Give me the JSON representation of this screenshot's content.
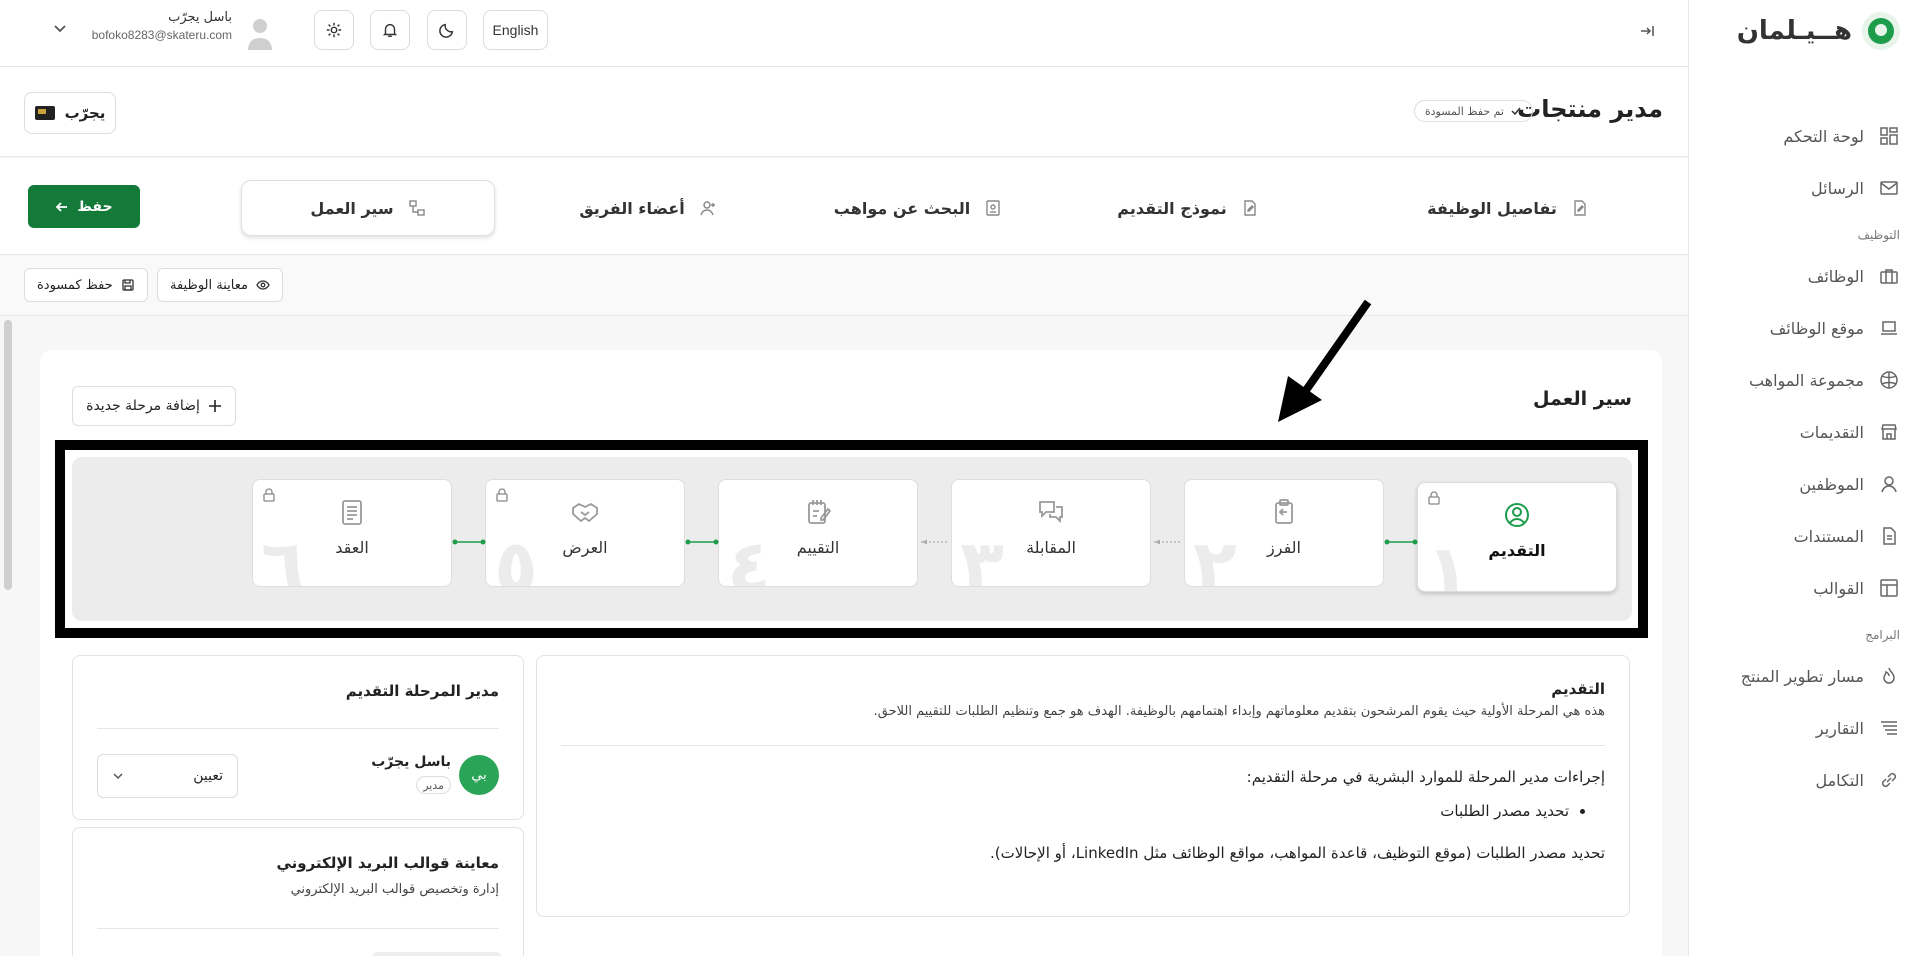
{
  "sidebar": {
    "brand": "هــيـلمان",
    "items": [
      {
        "label": "لوحة التحكم",
        "icon": "dashboard-icon"
      },
      {
        "label": "الرسائل",
        "icon": "mail-icon"
      }
    ],
    "section_hiring": "التوظيف",
    "hiring_items": [
      {
        "label": "الوظائف",
        "icon": "briefcase-icon"
      },
      {
        "label": "موقع الوظائف",
        "icon": "laptop-icon"
      },
      {
        "label": "مجموعة المواهب",
        "icon": "talent-pool-icon"
      },
      {
        "label": "التقديمات",
        "icon": "store-icon"
      },
      {
        "label": "الموظفين",
        "icon": "user-icon"
      },
      {
        "label": "المستندات",
        "icon": "document-icon"
      },
      {
        "label": "القوالب",
        "icon": "template-icon"
      }
    ],
    "section_programs": "البرامج",
    "program_items": [
      {
        "label": "مسار تطوير المنتج",
        "icon": "flame-icon"
      },
      {
        "label": "التقارير",
        "icon": "report-icon"
      },
      {
        "label": "التكامل",
        "icon": "link-icon"
      }
    ]
  },
  "topbar": {
    "language": "English",
    "user_name": "باسل يجرّب",
    "user_email": "bofoko8283@skateru.com"
  },
  "header": {
    "title": "مدير منتجات",
    "draft_badge": "تم حفظ المسودة",
    "company": "يجرّب"
  },
  "tabs": {
    "job_details": "تفاصيل الوظيفة",
    "application_form": "نموذج التقديم",
    "talent_search": "البحث عن مواهب",
    "team_members": "أعضاء الفريق",
    "workflow": "سير العمل",
    "save": "حفظ"
  },
  "actions": {
    "preview_job": "معاينة الوظيفة",
    "save_draft": "حفظ كمسودة"
  },
  "workflow": {
    "title": "سير العمل",
    "add_stage": "إضافة مرحلة جديدة",
    "stages": [
      {
        "label": "التقديم",
        "num": "١",
        "locked": true,
        "active": true
      },
      {
        "label": "الفرز",
        "num": "٢",
        "locked": false,
        "active": false
      },
      {
        "label": "المقابلة",
        "num": "٣",
        "locked": false,
        "active": false
      },
      {
        "label": "التقييم",
        "num": "٤",
        "locked": false,
        "active": false
      },
      {
        "label": "العرض",
        "num": "٥",
        "locked": true,
        "active": false
      },
      {
        "label": "العقد",
        "num": "٦",
        "locked": true,
        "active": false
      }
    ]
  },
  "stage_detail": {
    "title": "التقديم",
    "description": "هذه هي المرحلة الأولية حيث يقوم المرشحون بتقديم معلوماتهم وإبداء اهتمامهم بالوظيفة. الهدف هو جمع وتنظيم الطلبات للتقييم اللاحق.",
    "actions_heading": "إجراءات مدير المرحلة للموارد البشرية في مرحلة التقديم:",
    "bullets": [
      "تحديد مصدر الطلبات"
    ],
    "footer": "تحديد مصدر الطلبات (موقع التوظيف، قاعدة المواهب، مواقع الوظائف مثل LinkedIn، أو الإحالات)."
  },
  "manager": {
    "title": "مدير المرحلة التقديم",
    "avatar_initial": "بي",
    "name": "باسل يجرّب",
    "role": "مدير",
    "assign": "تعيين"
  },
  "email_templates": {
    "title": "معاينة قوالب البريد الإلكتروني",
    "subtitle": "إدارة وتخصيص قوالب البريد الإلكتروني"
  },
  "colors": {
    "accent": "#1d9d4b",
    "primary_button": "#137a3a"
  }
}
